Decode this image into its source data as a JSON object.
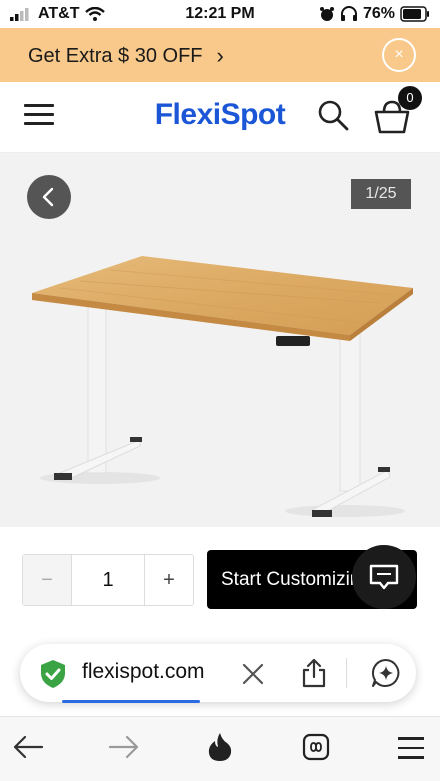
{
  "status_bar": {
    "carrier": "AT&T",
    "time": "12:21 PM",
    "battery": "76%"
  },
  "promo": {
    "text": "Get Extra $ 30 OFF",
    "chevron": "›",
    "close": "×"
  },
  "header": {
    "logo": "FlexiSpot",
    "cart_count": "0"
  },
  "gallery": {
    "counter": "1/25"
  },
  "purchase": {
    "minus": "−",
    "quantity": "1",
    "plus": "+",
    "cta_label": "Start Customizing"
  },
  "browser": {
    "url": "flexispot.com"
  },
  "colors": {
    "promo_bg": "#f8c98a",
    "brand_blue": "#1a56d6",
    "cta_bg": "#000000",
    "progress": "#2a6be3"
  },
  "icons": [
    "signal-icon",
    "wifi-icon",
    "alarm-icon",
    "headphones-icon",
    "battery-icon",
    "menu-icon",
    "search-icon",
    "cart-icon",
    "back-arrow-icon",
    "chat-icon",
    "shield-check-icon",
    "close-icon",
    "share-icon",
    "assistant-icon",
    "nav-back-icon",
    "nav-forward-icon",
    "flame-icon",
    "tabs-icon",
    "hamburger-icon"
  ]
}
